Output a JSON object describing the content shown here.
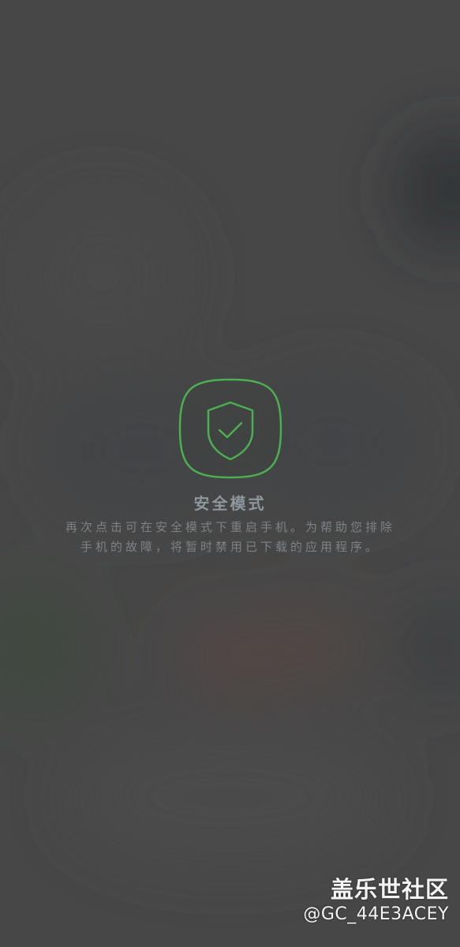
{
  "safe_mode": {
    "title": "安全模式",
    "description": "再次点击可在安全模式下重启手机。为帮助您排除手机的故障，将暂时禁用已下载的应用程序。",
    "accent_color": "#4caf50",
    "icon": "shield-check-icon"
  },
  "watermark": {
    "site": "盖乐世社区",
    "user": "@GC_44E3ACEY"
  }
}
